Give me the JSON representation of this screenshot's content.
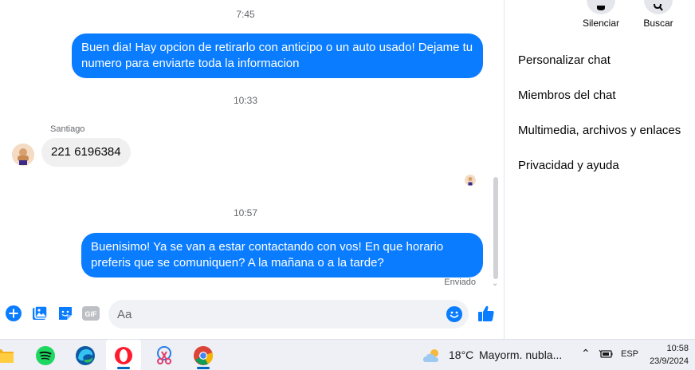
{
  "conversation": {
    "timestamps": [
      "7:45",
      "10:33",
      "10:57"
    ],
    "messages": [
      {
        "text": "Buen dia! Hay opcion de retirarlo con anticipo o un auto usado! Dejame tu numero para enviarte toda la informacion"
      },
      {
        "sender": "Santiago",
        "text": "221 6196384"
      },
      {
        "text": "Buenisimo! Ya se van a estar contactando con vos! En que horario preferis que se comuniquen? A la mañana o a la tarde?"
      }
    ],
    "status": "Enviado"
  },
  "composer": {
    "placeholder": "Aa",
    "accent": "#0a7cff"
  },
  "panel": {
    "actions": [
      {
        "label": "Silenciar",
        "icon": "bell-icon"
      },
      {
        "label": "Buscar",
        "icon": "search-icon"
      }
    ],
    "menu": [
      "Personalizar chat",
      "Miembros del chat",
      "Multimedia, archivos y enlaces",
      "Privacidad y ayuda"
    ]
  },
  "taskbar": {
    "apps": [
      "file-explorer-icon",
      "spotify-icon",
      "edge-icon",
      "opera-icon",
      "snipping-icon",
      "chrome-icon"
    ],
    "weather": {
      "temp": "18°C",
      "desc": "Mayorm. nubla..."
    },
    "language": "ESP",
    "time": "10:58",
    "date": "23/9/2024"
  }
}
